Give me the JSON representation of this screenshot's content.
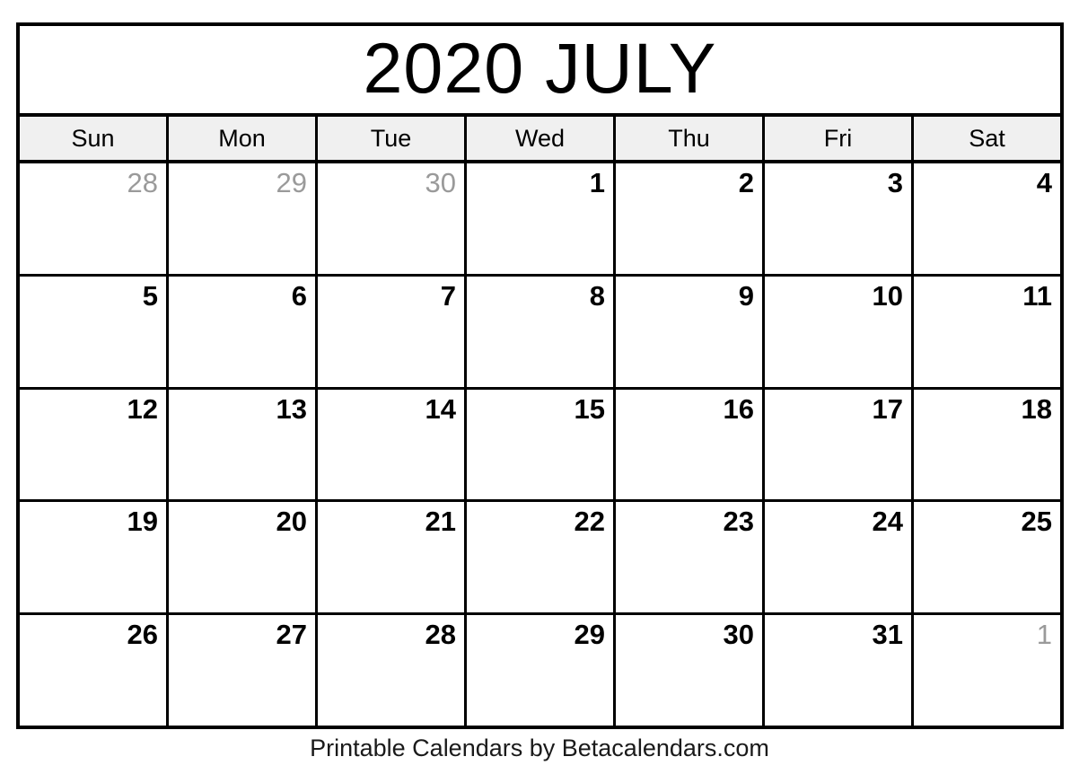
{
  "calendar": {
    "title": "2020 JULY",
    "month_name": "JULY",
    "year": "2020",
    "weekday_headers": [
      "Sun",
      "Mon",
      "Tue",
      "Wed",
      "Thu",
      "Fri",
      "Sat"
    ],
    "colors": {
      "border": "#000000",
      "header_background": "#f0f0f0",
      "current_month_text": "#000000",
      "adjacent_month_text": "#9a9a9a",
      "page_background": "#ffffff"
    },
    "weeks": [
      {
        "days": [
          {
            "label": "28",
            "in_month": false
          },
          {
            "label": "29",
            "in_month": false
          },
          {
            "label": "30",
            "in_month": false
          },
          {
            "label": "1",
            "in_month": true
          },
          {
            "label": "2",
            "in_month": true
          },
          {
            "label": "3",
            "in_month": true
          },
          {
            "label": "4",
            "in_month": true
          }
        ]
      },
      {
        "days": [
          {
            "label": "5",
            "in_month": true
          },
          {
            "label": "6",
            "in_month": true
          },
          {
            "label": "7",
            "in_month": true
          },
          {
            "label": "8",
            "in_month": true
          },
          {
            "label": "9",
            "in_month": true
          },
          {
            "label": "10",
            "in_month": true
          },
          {
            "label": "11",
            "in_month": true
          }
        ]
      },
      {
        "days": [
          {
            "label": "12",
            "in_month": true
          },
          {
            "label": "13",
            "in_month": true
          },
          {
            "label": "14",
            "in_month": true
          },
          {
            "label": "15",
            "in_month": true
          },
          {
            "label": "16",
            "in_month": true
          },
          {
            "label": "17",
            "in_month": true
          },
          {
            "label": "18",
            "in_month": true
          }
        ]
      },
      {
        "days": [
          {
            "label": "19",
            "in_month": true
          },
          {
            "label": "20",
            "in_month": true
          },
          {
            "label": "21",
            "in_month": true
          },
          {
            "label": "22",
            "in_month": true
          },
          {
            "label": "23",
            "in_month": true
          },
          {
            "label": "24",
            "in_month": true
          },
          {
            "label": "25",
            "in_month": true
          }
        ]
      },
      {
        "days": [
          {
            "label": "26",
            "in_month": true
          },
          {
            "label": "27",
            "in_month": true
          },
          {
            "label": "28",
            "in_month": true
          },
          {
            "label": "29",
            "in_month": true
          },
          {
            "label": "30",
            "in_month": true
          },
          {
            "label": "31",
            "in_month": true
          },
          {
            "label": "1",
            "in_month": false
          }
        ]
      }
    ]
  },
  "footer": {
    "text": "Printable Calendars by Betacalendars.com"
  }
}
